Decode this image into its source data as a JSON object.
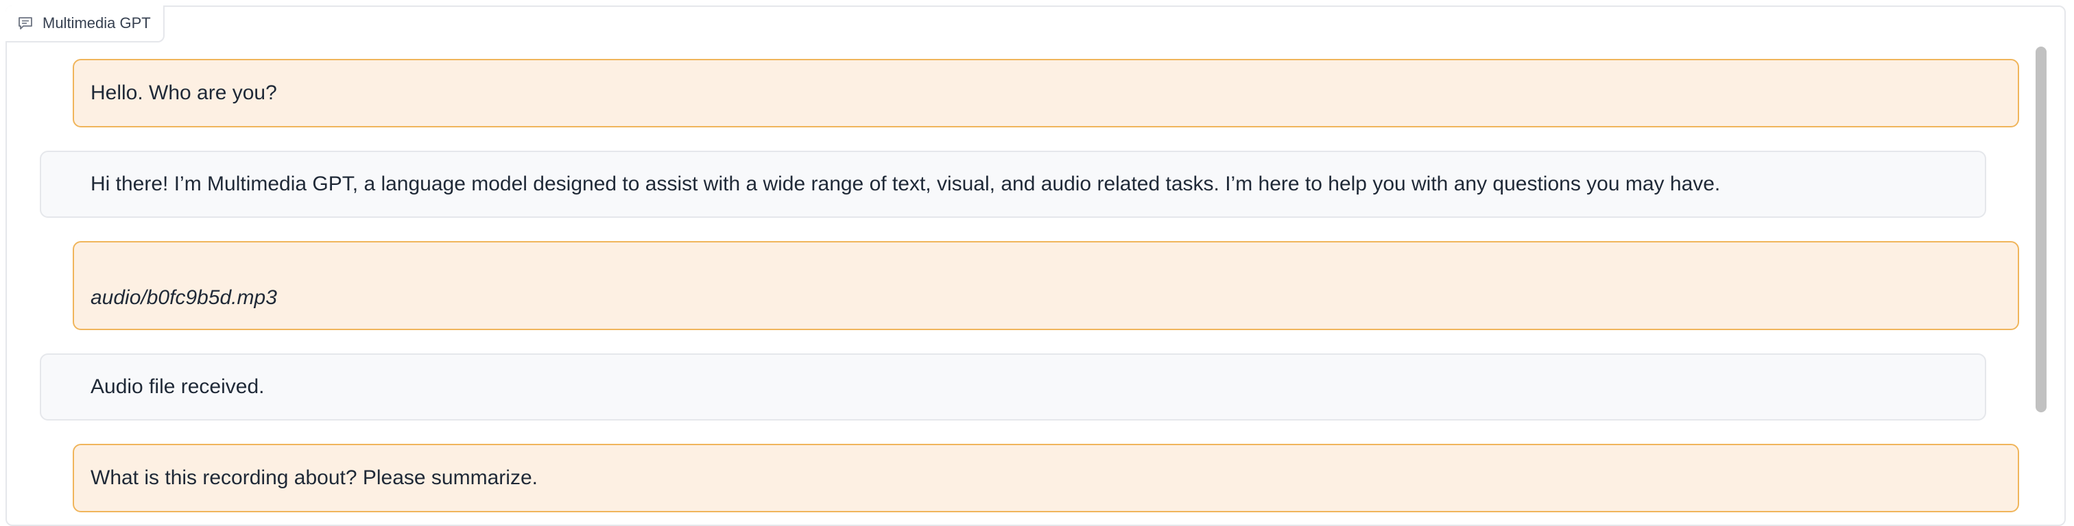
{
  "chatbot": {
    "label": "Multimedia GPT",
    "label_icon": "chat-icon"
  },
  "messages": [
    {
      "role": "user",
      "text": "Hello. Who are you?"
    },
    {
      "role": "bot",
      "text": "Hi there! I’m Multimedia GPT, a language model designed to assist with a wide range of text, visual, and audio related tasks. I’m here to help you with any questions you may have."
    },
    {
      "role": "user",
      "text": "audio/b0fc9b5d.mp3"
    },
    {
      "role": "bot",
      "text": "Audio file received."
    },
    {
      "role": "user",
      "text": "What is this recording about? Please summarize."
    }
  ],
  "colors": {
    "user_bubble_bg": "#fdf0e3",
    "user_bubble_border": "#f0b55b",
    "bot_bubble_bg": "#f8f9fb",
    "bot_bubble_border": "#e5e7eb"
  }
}
